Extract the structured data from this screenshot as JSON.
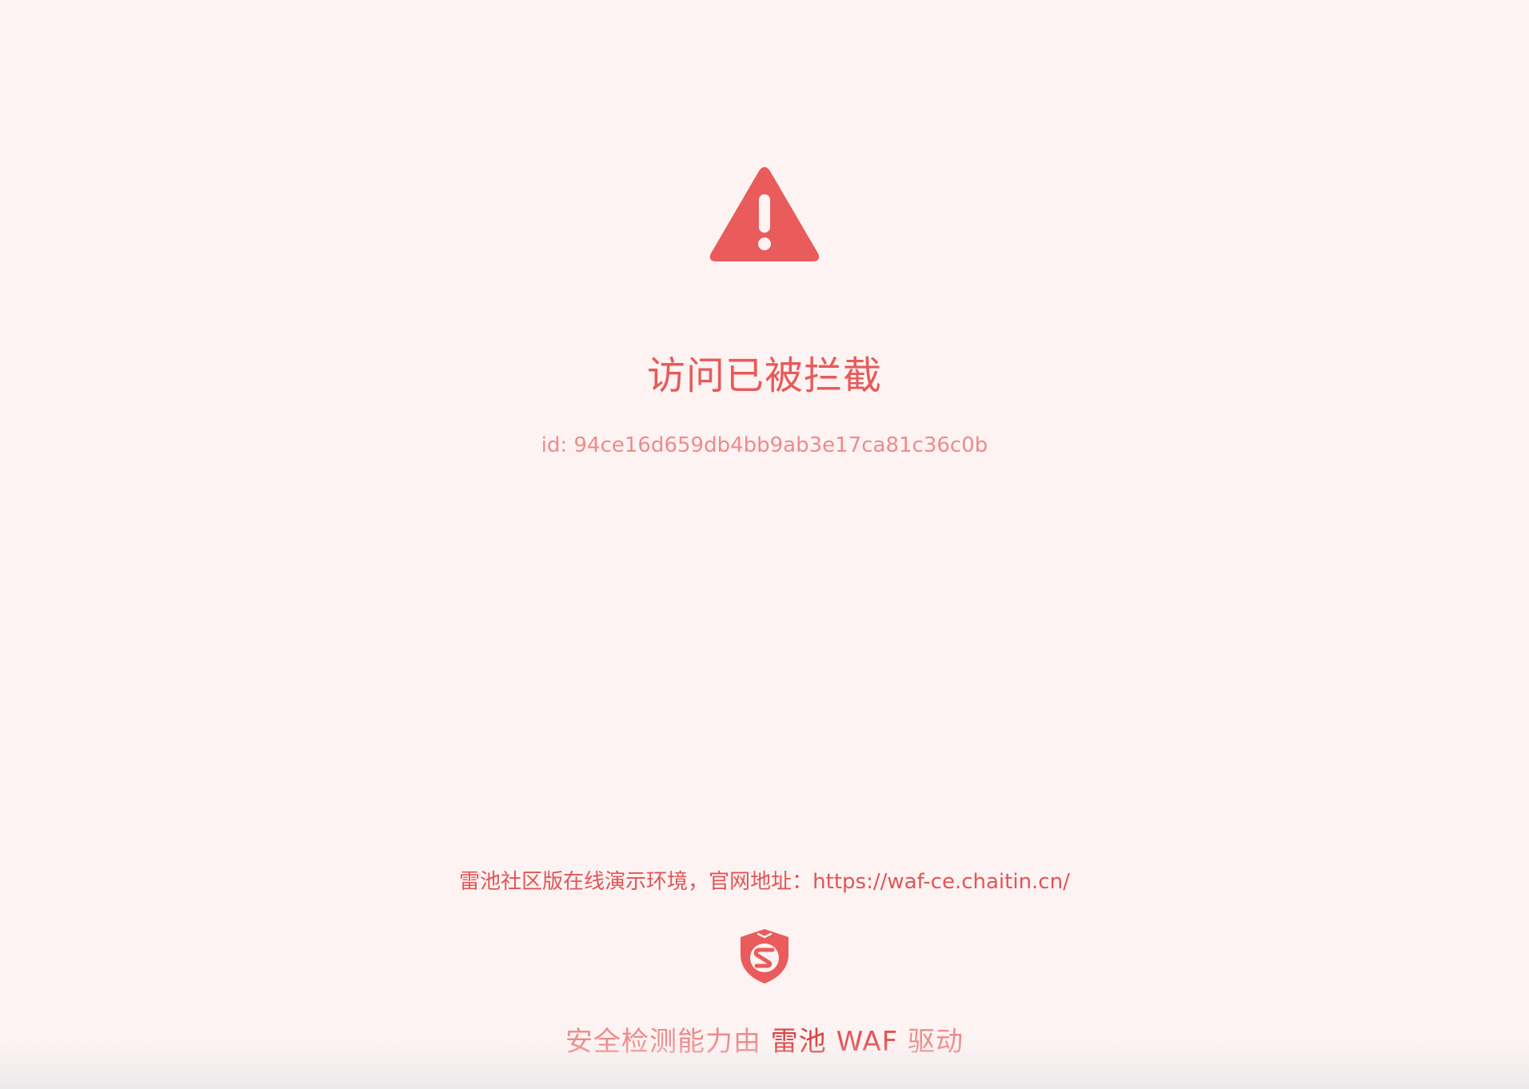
{
  "colors": {
    "background": "#fdf3f3",
    "accent": "#ea5b5b",
    "muted": "#ee8b8b"
  },
  "icons": {
    "warning": "warning-triangle-icon",
    "logo": "safeline-shield-icon"
  },
  "blocked": {
    "title": "访问已被拦截",
    "request_id": "id: 94ce16d659db4bb9ab3e17ca81c36c0b"
  },
  "footer": {
    "demo_text": "雷池社区版在线演示环境，官网地址：",
    "demo_link": "https://waf-ce.chaitin.cn/",
    "powered_prefix": "安全检测能力由",
    "powered_brand": "雷池",
    "powered_product": "WAF",
    "powered_suffix": "驱动"
  }
}
